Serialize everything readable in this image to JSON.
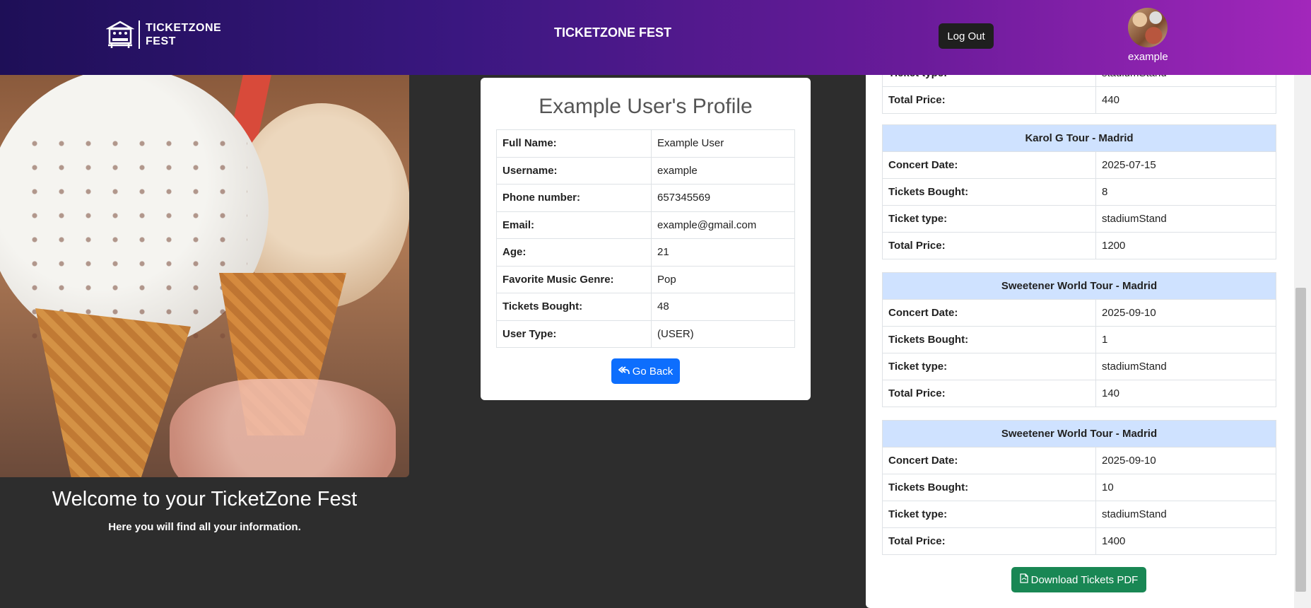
{
  "header": {
    "logo_line1": "TICKETZONE",
    "logo_line2": "FEST",
    "title": "TICKETZONE FEST",
    "logout_label": "Log Out",
    "username": "example"
  },
  "welcome": {
    "title": "Welcome to your TicketZone Fest",
    "subtitle": "Here you will find all your information."
  },
  "profile": {
    "title": "Example User's Profile",
    "rows": [
      {
        "label": "Full Name:",
        "value": "Example User"
      },
      {
        "label": "Username:",
        "value": "example"
      },
      {
        "label": "Phone number:",
        "value": "657345569"
      },
      {
        "label": "Email:",
        "value": "example@gmail.com"
      },
      {
        "label": "Age:",
        "value": "21"
      },
      {
        "label": "Favorite Music Genre:",
        "value": "Pop"
      },
      {
        "label": "Tickets Bought:",
        "value": "48"
      },
      {
        "label": "User Type:",
        "value": "(USER)"
      }
    ],
    "go_back_label": "Go Back"
  },
  "tickets": {
    "partial": {
      "rows": [
        {
          "label": "Ticket type:",
          "value": "stadiumStand"
        },
        {
          "label": "Total Price:",
          "value": "440"
        }
      ]
    },
    "orders": [
      {
        "concert": "Karol G Tour - Madrid",
        "rows": [
          {
            "label": "Concert Date:",
            "value": "2025-07-15"
          },
          {
            "label": "Tickets Bought:",
            "value": "8"
          },
          {
            "label": "Ticket type:",
            "value": "stadiumStand"
          },
          {
            "label": "Total Price:",
            "value": "1200"
          }
        ]
      },
      {
        "concert": "Sweetener World Tour - Madrid",
        "rows": [
          {
            "label": "Concert Date:",
            "value": "2025-09-10"
          },
          {
            "label": "Tickets Bought:",
            "value": "1"
          },
          {
            "label": "Ticket type:",
            "value": "stadiumStand"
          },
          {
            "label": "Total Price:",
            "value": "140"
          }
        ]
      },
      {
        "concert": "Sweetener World Tour - Madrid",
        "rows": [
          {
            "label": "Concert Date:",
            "value": "2025-09-10"
          },
          {
            "label": "Tickets Bought:",
            "value": "10"
          },
          {
            "label": "Ticket type:",
            "value": "stadiumStand"
          },
          {
            "label": "Total Price:",
            "value": "1400"
          }
        ]
      }
    ],
    "download_label": "Download Tickets PDF"
  },
  "icons": {
    "logo": "stage-logo-icon",
    "go_back": "reply-all-icon",
    "download": "file-pdf-icon"
  }
}
